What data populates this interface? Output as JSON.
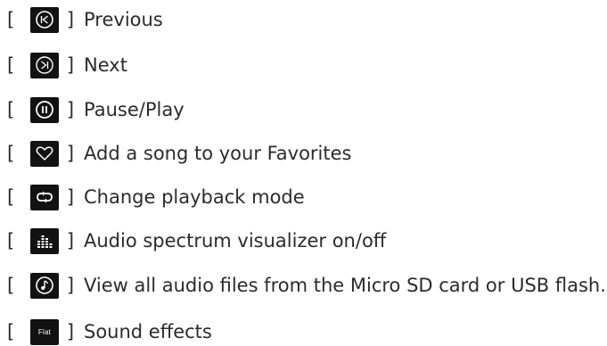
{
  "brackets": {
    "open": "[",
    "close": "]"
  },
  "items": [
    {
      "icon": "previous-icon",
      "label": "Previous"
    },
    {
      "icon": "next-icon",
      "label": "Next"
    },
    {
      "icon": "pause-play-icon",
      "label": "Pause/Play"
    },
    {
      "icon": "heart-icon",
      "label": "Add a song to your Favorites"
    },
    {
      "icon": "repeat-icon",
      "label": "Change playback mode"
    },
    {
      "icon": "spectrum-icon",
      "label": "Audio spectrum visualizer on/off"
    },
    {
      "icon": "music-note-icon",
      "label": "View all audio files from the Micro SD card or USB flash."
    },
    {
      "icon": "flat-eq-icon",
      "label": "Sound effects",
      "icon_text": "Flat"
    }
  ]
}
